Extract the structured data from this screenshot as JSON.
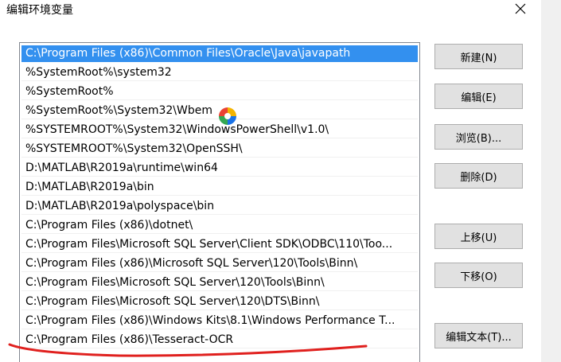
{
  "window": {
    "title": "编辑环境变量"
  },
  "path_list": {
    "items": [
      "C:\\Program Files (x86)\\Common Files\\Oracle\\Java\\javapath",
      "%SystemRoot%\\system32",
      "%SystemRoot%",
      "%SystemRoot%\\System32\\Wbem",
      "%SYSTEMROOT%\\System32\\WindowsPowerShell\\v1.0\\",
      "%SYSTEMROOT%\\System32\\OpenSSH\\",
      "D:\\MATLAB\\R2019a\\runtime\\win64",
      "D:\\MATLAB\\R2019a\\bin",
      "D:\\MATLAB\\R2019a\\polyspace\\bin",
      "C:\\Program Files (x86)\\dotnet\\",
      "C:\\Program Files\\Microsoft SQL Server\\Client SDK\\ODBC\\110\\Too...",
      "C:\\Program Files (x86)\\Microsoft SQL Server\\120\\Tools\\Binn\\",
      "C:\\Program Files\\Microsoft SQL Server\\120\\Tools\\Binn\\",
      "C:\\Program Files\\Microsoft SQL Server\\120\\DTS\\Binn\\",
      "C:\\Program Files (x86)\\Windows Kits\\8.1\\Windows Performance T...",
      "C:\\Program Files (x86)\\Tesseract-OCR"
    ],
    "selected_index": 0
  },
  "buttons": {
    "new": "新建(N)",
    "edit": "编辑(E)",
    "browse": "浏览(B)...",
    "delete": "删除(D)",
    "move_up": "上移(U)",
    "move_down": "下移(O)",
    "edit_text": "编辑文本(T)..."
  },
  "colors": {
    "selection": "#3390ef",
    "annotation": "#e0201e"
  }
}
